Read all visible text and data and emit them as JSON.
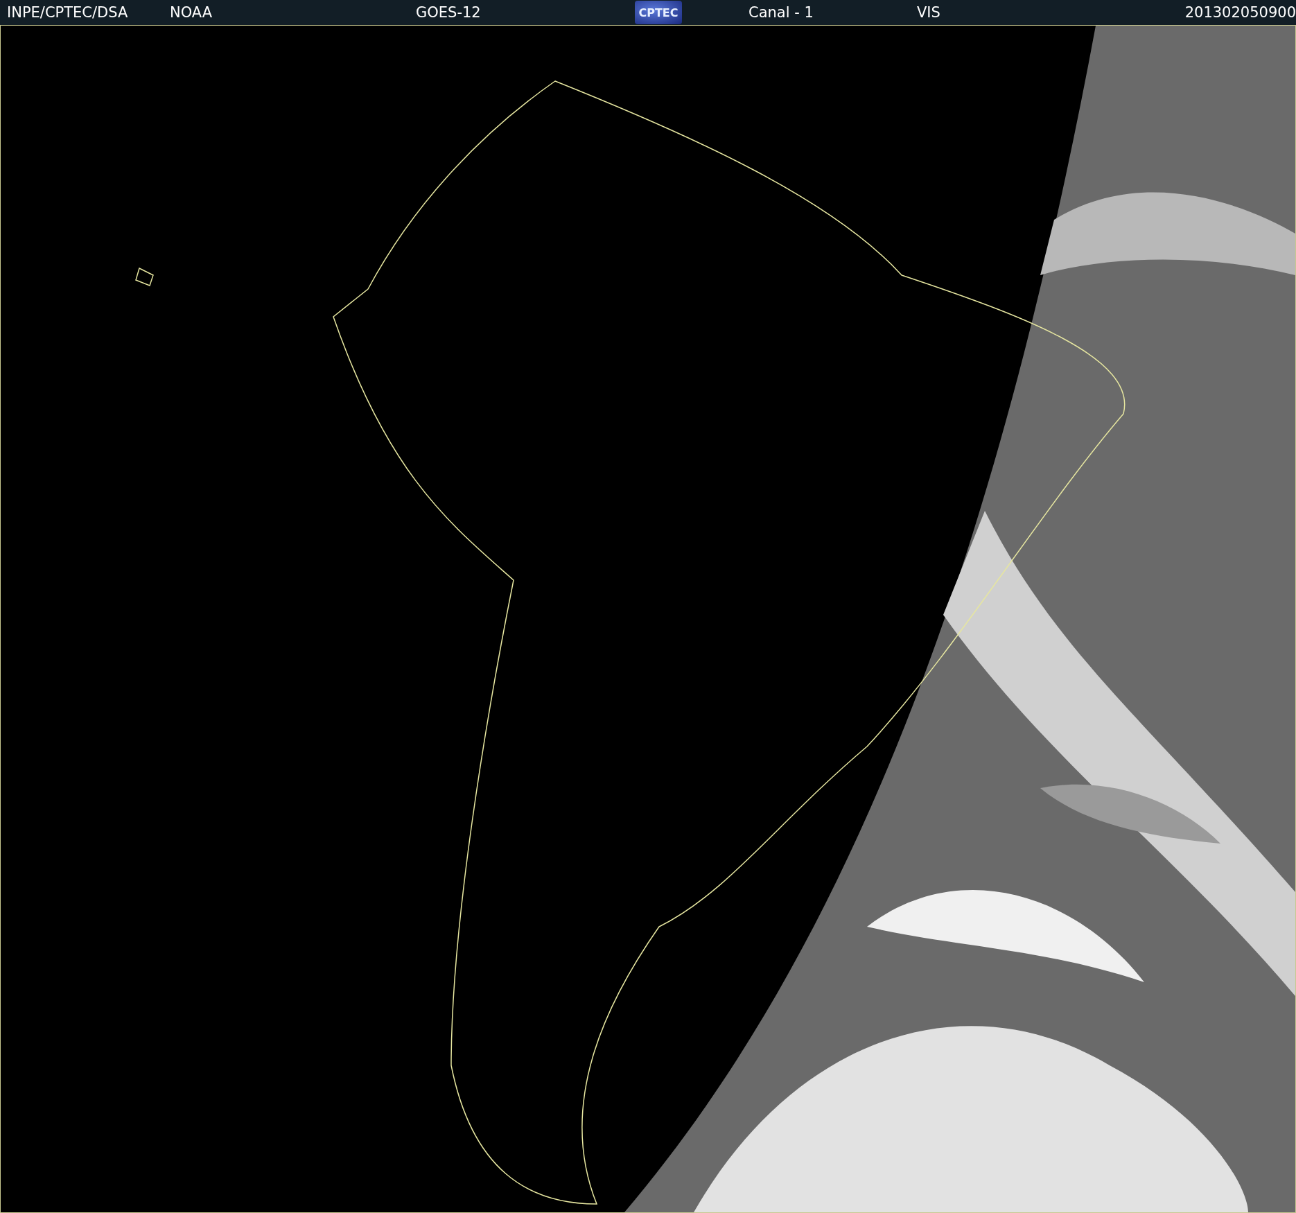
{
  "header": {
    "items": [
      {
        "kind": "text",
        "text": "INPE/CPTEC/DSA"
      },
      {
        "kind": "text",
        "text": "NOAA"
      },
      {
        "kind": "text",
        "text": "GOES-12"
      },
      {
        "kind": "logo",
        "text": "CPTEC"
      },
      {
        "kind": "text",
        "text": "Canal - 1"
      },
      {
        "kind": "text",
        "text": "VIS"
      },
      {
        "kind": "text",
        "text": "201302050900"
      }
    ]
  }
}
